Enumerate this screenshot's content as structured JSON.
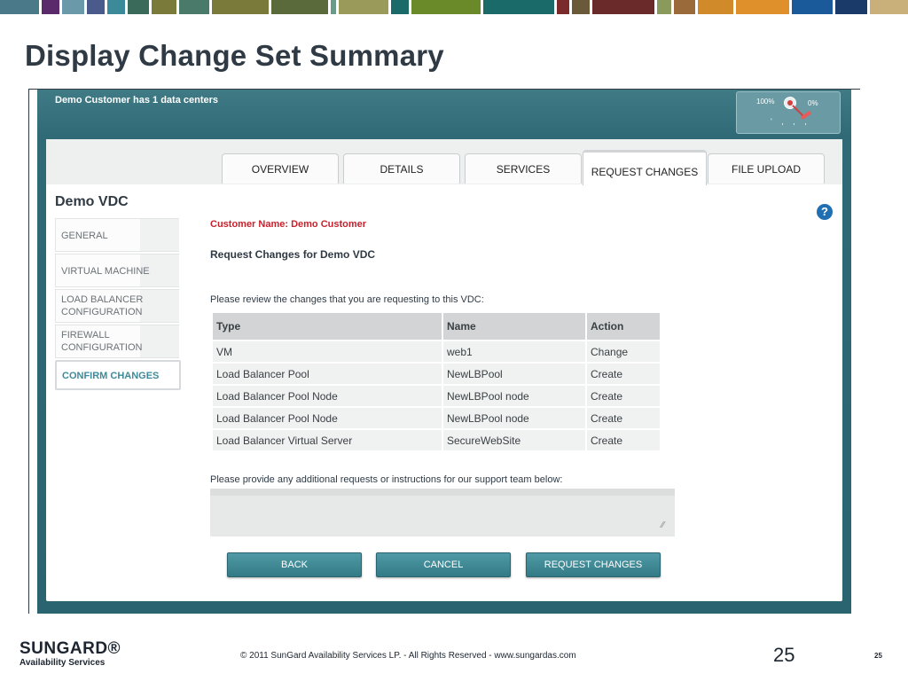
{
  "slide": {
    "title": "Display Change Set Summary",
    "strip_colors": [
      "#4a7a8a",
      "#5a2a6a",
      "#6a9aaa",
      "#4a5a8a",
      "#3a8a9a",
      "#3a6a5a",
      "#7a7a3a",
      "#4a7a6a",
      "#7a7a3a",
      "#5a6a3a",
      "#6a9a8a",
      "#9a9a5a",
      "#1a6a6a",
      "#6a8a2a",
      "#1a6a6a",
      "#7a2a2a",
      "#6a5a3a",
      "#6a2a2a",
      "#8a9a5a",
      "#9a6a3a",
      "#d08a2a",
      "#e0902a",
      "#1a5a9a",
      "#1a3a6a",
      "#c9b07a"
    ]
  },
  "app": {
    "header_text": "Demo Customer has 1 data centers",
    "zoom": {
      "left_label": "100%",
      "right_label": "0%",
      "ticks": "' , , ,",
      "knob_icon": "zoom-knob-icon",
      "pencil_icon": "pencil-icon"
    },
    "tabs": [
      {
        "label": "OVERVIEW",
        "active": false
      },
      {
        "label": "DETAILS",
        "active": false
      },
      {
        "label": "SERVICES",
        "active": false
      },
      {
        "label": "REQUEST CHANGES",
        "active": true
      },
      {
        "label": "FILE UPLOAD",
        "active": false
      }
    ],
    "vdc_title": "Demo VDC",
    "help_icon": "?",
    "sidebar": [
      {
        "label": "GENERAL"
      },
      {
        "label": "VIRTUAL MACHINE"
      },
      {
        "label": "LOAD BALANCER CONFIGURATION"
      },
      {
        "label": "FIREWALL CONFIGURATION"
      },
      {
        "label": "CONFIRM CHANGES",
        "active": true
      }
    ],
    "customer_name": "Customer Name: Demo Customer",
    "request_title": "Request Changes for Demo VDC",
    "review_text": "Please review the changes that you are requesting to this VDC:",
    "table": {
      "headers": [
        "Type",
        "Name",
        "Action"
      ],
      "rows": [
        [
          "VM",
          "web1",
          "Change"
        ],
        [
          "Load Balancer Pool",
          "NewLBPool",
          "Create"
        ],
        [
          "Load Balancer Pool Node",
          "NewLBPool node",
          "Create"
        ],
        [
          "Load Balancer Pool Node",
          "NewLBPool node",
          "Create"
        ],
        [
          "Load Balancer Virtual Server",
          "SecureWebSite",
          "Create"
        ]
      ]
    },
    "provide_text": "Please provide any additional requests or instructions for our support team below:",
    "notes_value": "",
    "buttons": {
      "back": "BACK",
      "cancel": "CANCEL",
      "request": "REQUEST CHANGES"
    }
  },
  "footer": {
    "logo_top": "SUNGARD®",
    "logo_bottom": "Availability Services",
    "copyright": "© 2011 SunGard Availability Services LP. - All Rights Reserved - www.sungardas.com",
    "page_big": "25",
    "page_small": "25"
  }
}
